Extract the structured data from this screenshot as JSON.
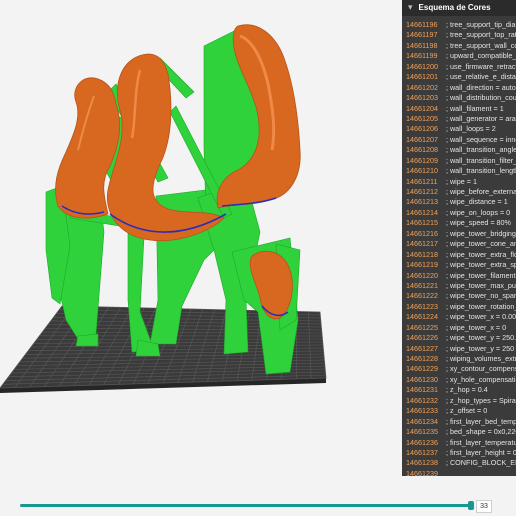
{
  "panel": {
    "title": "Esquema de Cores",
    "lines": [
      {
        "n": "14661196",
        "code": "; tree_support_tip_diam"
      },
      {
        "n": "14661197",
        "code": "; tree_support_top_rate"
      },
      {
        "n": "14661198",
        "code": "; tree_support_wall_cou"
      },
      {
        "n": "14661199",
        "code": "; upward_compatible_m"
      },
      {
        "n": "14661200",
        "code": "; use_firmware_retractio"
      },
      {
        "n": "14661201",
        "code": "; use_relative_e_distanc"
      },
      {
        "n": "14661202",
        "code": "; wall_direction = auto"
      },
      {
        "n": "14661203",
        "code": "; wall_distribution_coun"
      },
      {
        "n": "14661204",
        "code": "; wall_filament = 1"
      },
      {
        "n": "14661205",
        "code": "; wall_generator = arach"
      },
      {
        "n": "14661206",
        "code": "; wall_loops = 2"
      },
      {
        "n": "14661207",
        "code": "; wall_sequence = inner"
      },
      {
        "n": "14661208",
        "code": "; wall_transition_angle ="
      },
      {
        "n": "14661209",
        "code": "; wall_transition_filter_d"
      },
      {
        "n": "14661210",
        "code": "; wall_transition_length"
      },
      {
        "n": "14661211",
        "code": "; wipe = 1"
      },
      {
        "n": "14661212",
        "code": "; wipe_before_external_"
      },
      {
        "n": "14661213",
        "code": "; wipe_distance = 1"
      },
      {
        "n": "14661214",
        "code": "; wipe_on_loops = 0"
      },
      {
        "n": "14661215",
        "code": "; wipe_speed = 80%"
      },
      {
        "n": "14661216",
        "code": "; wipe_tower_bridging ="
      },
      {
        "n": "14661217",
        "code": "; wipe_tower_cone_ang"
      },
      {
        "n": "14661218",
        "code": "; wipe_tower_extra_flow"
      },
      {
        "n": "14661219",
        "code": "; wipe_tower_extra_spa"
      },
      {
        "n": "14661220",
        "code": "; wipe_tower_filament ="
      },
      {
        "n": "14661221",
        "code": "; wipe_tower_max_purg"
      },
      {
        "n": "14661222",
        "code": "; wipe_tower_no_sparse"
      },
      {
        "n": "14661223",
        "code": "; wipe_tower_rotation_a"
      },
      {
        "n": "14661224",
        "code": "; wipe_tower_x = 0.000"
      },
      {
        "n": "14661225",
        "code": "; wipe_tower_x = 0"
      },
      {
        "n": "14661226",
        "code": "; wipe_tower_y = 250.00"
      },
      {
        "n": "14661227",
        "code": "; wipe_tower_y = 250"
      },
      {
        "n": "14661228",
        "code": "; wiping_volumes_extru"
      },
      {
        "n": "14661229",
        "code": "; xy_contour_compensat"
      },
      {
        "n": "14661230",
        "code": "; xy_hole_compensation"
      },
      {
        "n": "14661231",
        "code": "; z_hop = 0.4"
      },
      {
        "n": "14661232",
        "code": "; z_hop_types = Spiral L"
      },
      {
        "n": "14661233",
        "code": "; z_offset = 0"
      },
      {
        "n": "14661234",
        "code": "; first_layer_bed_tempe"
      },
      {
        "n": "14661235",
        "code": "; bed_shape = 0x0,220x"
      },
      {
        "n": "14661236",
        "code": "; first_layer_temperatu"
      },
      {
        "n": "14661237",
        "code": "; first_layer_height = 0.2"
      },
      {
        "n": "14661238",
        "code": "; CONFIG_BLOCK_END"
      },
      {
        "n": "14661239",
        "code": ""
      }
    ]
  },
  "slider": {
    "value": "33",
    "fraction": 0.998
  },
  "colors": {
    "model": "#d8681f",
    "model_highlight": "#ee8a45",
    "support": "#2fd23a",
    "support_dark": "#1ea82a",
    "interface": "#2b2fb8",
    "bed": "#3a3a3a",
    "accent": "#17998f"
  }
}
